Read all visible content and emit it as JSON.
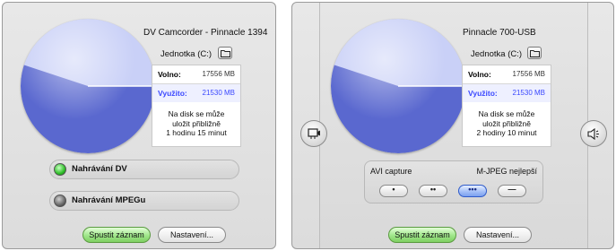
{
  "left_panel": {
    "device_name": "DV Camcorder - Pinnacle 1394",
    "drive_label": "Jednotka (C:)",
    "free_label": "Volno:",
    "free_value": "17556 MB",
    "used_label": "Využito:",
    "used_value": "21530 MB",
    "estimate": [
      "Na disk se může",
      "uložit přibližně",
      "1 hodinu 15 minut"
    ],
    "modes": [
      {
        "label": "Nahrávání DV",
        "active": true
      },
      {
        "label": "Nahrávání MPEGu",
        "active": false
      }
    ],
    "start_button": "Spustit záznam",
    "settings_button": "Nastavení..."
  },
  "right_panel": {
    "device_name": "Pinnacle 700-USB",
    "drive_label": "Jednotka (C:)",
    "free_label": "Volno:",
    "free_value": "17556 MB",
    "used_label": "Využito:",
    "used_value": "21530 MB",
    "estimate": [
      "Na disk se může",
      "uložit přibližně",
      "2 hodiny 10 minut"
    ],
    "quality": {
      "left_label": "AVI capture",
      "right_label": "M-JPEG nejlepší",
      "options": [
        "•",
        "••",
        "•••",
        "—"
      ],
      "selected_index": 2
    },
    "start_button": "Spustit záznam",
    "settings_button": "Nastavení..."
  },
  "disk_usage": {
    "used_mb": 21530,
    "free_mb": 17556
  },
  "colors": {
    "disk_used": "#5a68cf",
    "disk_free": "#c9d0f7",
    "used_text": "#3a48ff",
    "led_on": "#2fbf29",
    "start_button": "#9fe68a",
    "selected_quality": "#9fbcf7"
  },
  "icons": {
    "folder": "folder-icon",
    "video_input": "video-input-icon",
    "audio_input": "speaker-icon"
  }
}
